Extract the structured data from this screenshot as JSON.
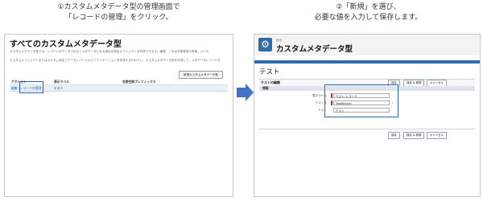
{
  "captions": {
    "left": [
      "①カスタムメタデータ型の管理画面で",
      "「レコードの管理」をクリック。"
    ],
    "right": [
      "②「新規」を選び、",
      "必要な値を入力して保存します。"
    ]
  },
  "left_panel": {
    "title": "すべてのカスタムメタデータ型",
    "desc1": "カスタムメタデータ型では、レコードがデータではなくメタデータになる独自の設定オブジェクトを作成できます。通常、これは非常検索の有無、パッケ",
    "desc2": "カスタムオブジェクトまたはカスタム設定でデータレコードからアプリケーションを作成する代わりに、カスタムメタデータ型を作成して、メタデータレコードを",
    "new_button": "新規カスタムメタデータ型",
    "columns": [
      "アクション",
      "表示ラベル",
      "名前空間プレフィックス"
    ],
    "row": {
      "action_edit": "編集",
      "action_sep": "|",
      "action_manage": "レコードの管理",
      "label": "テスト",
      "namespace": ""
    }
  },
  "right_panel": {
    "setup_label": "設定",
    "title": "カスタムメタデータ型",
    "icon": "gear-icon",
    "record_name": "テスト",
    "edit_section_title": "テストの編集",
    "buttons": {
      "save": "保存",
      "save_new": "保存 & 新規",
      "cancel": "キャンセル"
    },
    "info_section_label": "情報",
    "fields": [
      {
        "label": "表示ラベル",
        "value": "テスト-レコード"
      },
      {
        "label": "テスト名",
        "value": "TestRecord"
      },
      {
        "label": "テスト",
        "value": "テスト"
      }
    ],
    "info_icon": "i"
  },
  "colors": {
    "highlight": "#2b63ad",
    "arrow": "#4472c4",
    "header_bar": "#2f6cae",
    "icon_bg": "#2e6ba8",
    "required_marker": "#c23934"
  }
}
